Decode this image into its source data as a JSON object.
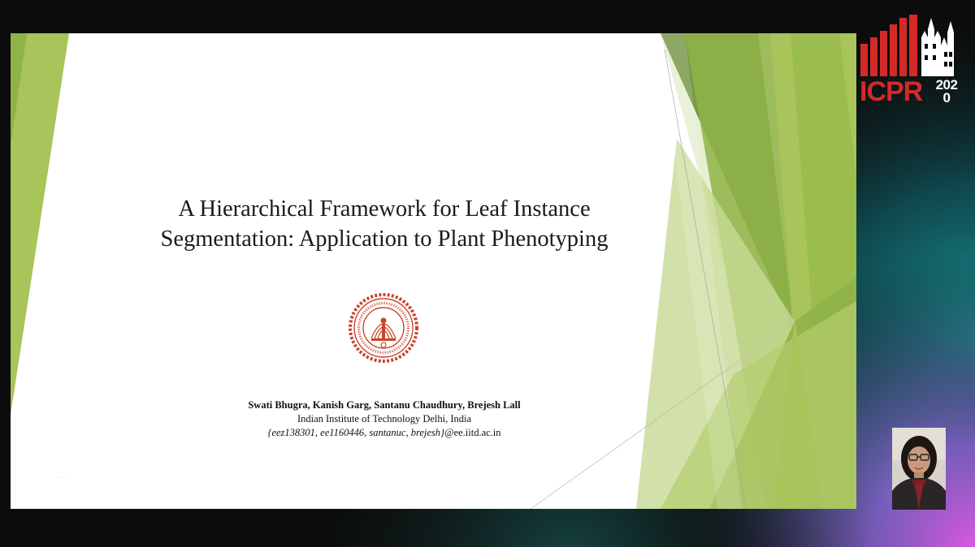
{
  "slide": {
    "title_line1": "A Hierarchical Framework for Leaf Instance",
    "title_line2": "Segmentation: Application to Plant Phenotyping",
    "authors": "Swati Bhugra, Kanish Garg, Santanu Chaudhury, Brejesh Lall",
    "affiliation": "Indian Institute of Technology Delhi, India",
    "email_ids": "{eez138301, ee1160446, santanuc, brejesh}",
    "email_domain": "@ee.iitd.ac.in",
    "logo_icon": "iit-delhi-seal-icon",
    "accent_colors": {
      "green_light": "#a8c45a",
      "green_mid": "#8fb347",
      "green_dark": "#6e8f3a",
      "logo_red": "#c9452b"
    }
  },
  "conference": {
    "name": "ICPR",
    "year": "2020",
    "logo_icon": "icpr-skyline-icon",
    "brand_color": "#d42a27"
  },
  "webcam": {
    "icon": "presenter-webcam-icon"
  }
}
